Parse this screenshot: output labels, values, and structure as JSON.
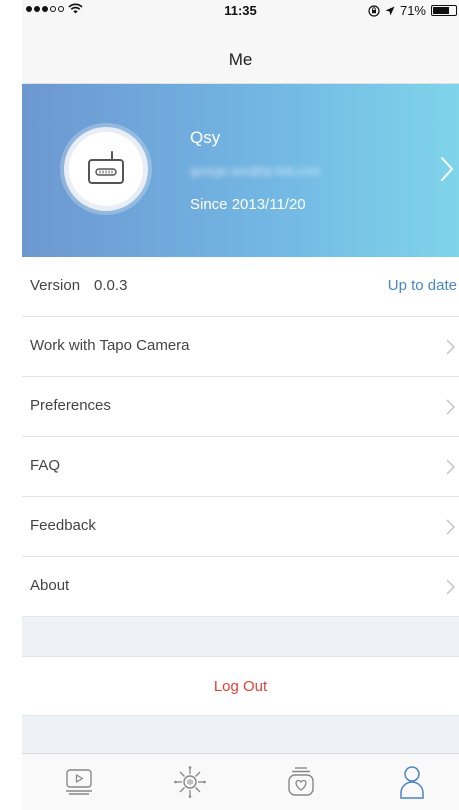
{
  "status_bar": {
    "time": "11:35",
    "battery": "71%",
    "battery_level": 0.71,
    "signal_bars_filled": 3,
    "signal_bars_total": 5
  },
  "nav": {
    "title": "Me"
  },
  "profile": {
    "name": "Qsy",
    "email": "george.seo@tp-link.com",
    "since": "Since 2013/11/20"
  },
  "version_row": {
    "label": "Version",
    "number": "0.0.3",
    "status": "Up to date"
  },
  "menu": [
    {
      "label": "Work with Tapo Camera"
    },
    {
      "label": "Preferences"
    },
    {
      "label": "FAQ"
    },
    {
      "label": "Feedback"
    },
    {
      "label": "About"
    }
  ],
  "logout": {
    "label": "Log Out"
  },
  "tabs": [
    {
      "name": "tab-videos",
      "icon": "play-screen-icon"
    },
    {
      "name": "tab-devices",
      "icon": "device-hub-icon"
    },
    {
      "name": "tab-moments",
      "icon": "heart-stack-icon"
    },
    {
      "name": "tab-me",
      "icon": "person-icon"
    }
  ],
  "colors": {
    "accent_blue": "#4a86c5",
    "logout_red": "#e0423a",
    "banner_start": "#6d97d0",
    "banner_end": "#7fd4ea",
    "active_tab": "#4a86c5"
  }
}
